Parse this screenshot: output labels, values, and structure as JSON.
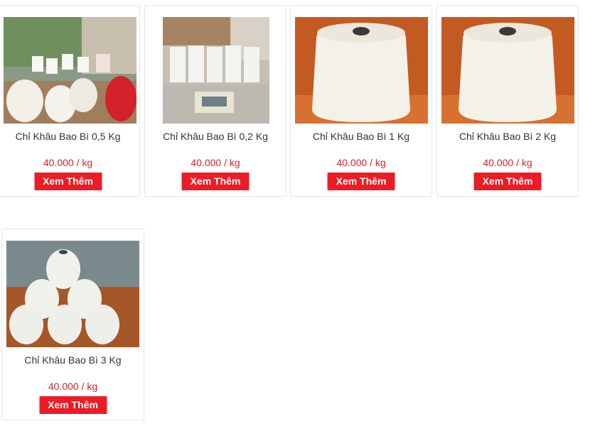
{
  "products": [
    {
      "title": "Chỉ Khâu Bao Bì 0,5 Kg",
      "price": "40.000 / kg",
      "button": "Xem Thêm",
      "image": "assorted-thread-spools-photo"
    },
    {
      "title": "Chỉ Khâu Bao Bì 0,2 Kg",
      "price": "40.000 / kg",
      "button": "Xem Thêm",
      "image": "thread-spools-on-scale-photo"
    },
    {
      "title": "Chỉ Khâu Bao Bì 1 Kg",
      "price": "40.000 / kg",
      "button": "Xem Thêm",
      "image": "large-thread-cone-photo"
    },
    {
      "title": "Chỉ Khâu Bao Bì 2 Kg",
      "price": "40.000 / kg",
      "button": "Xem Thêm",
      "image": "large-thread-cone-photo"
    },
    {
      "title": "Chỉ Khâu Bao Bì 3 Kg",
      "price": "40.000 / kg",
      "button": "Xem Thêm",
      "image": "stacked-thread-cones-photo"
    }
  ],
  "colors": {
    "price": "#d8232a",
    "button_bg": "#ed1c24",
    "button_text": "#ffffff",
    "card_border": "#e6e6e6"
  }
}
